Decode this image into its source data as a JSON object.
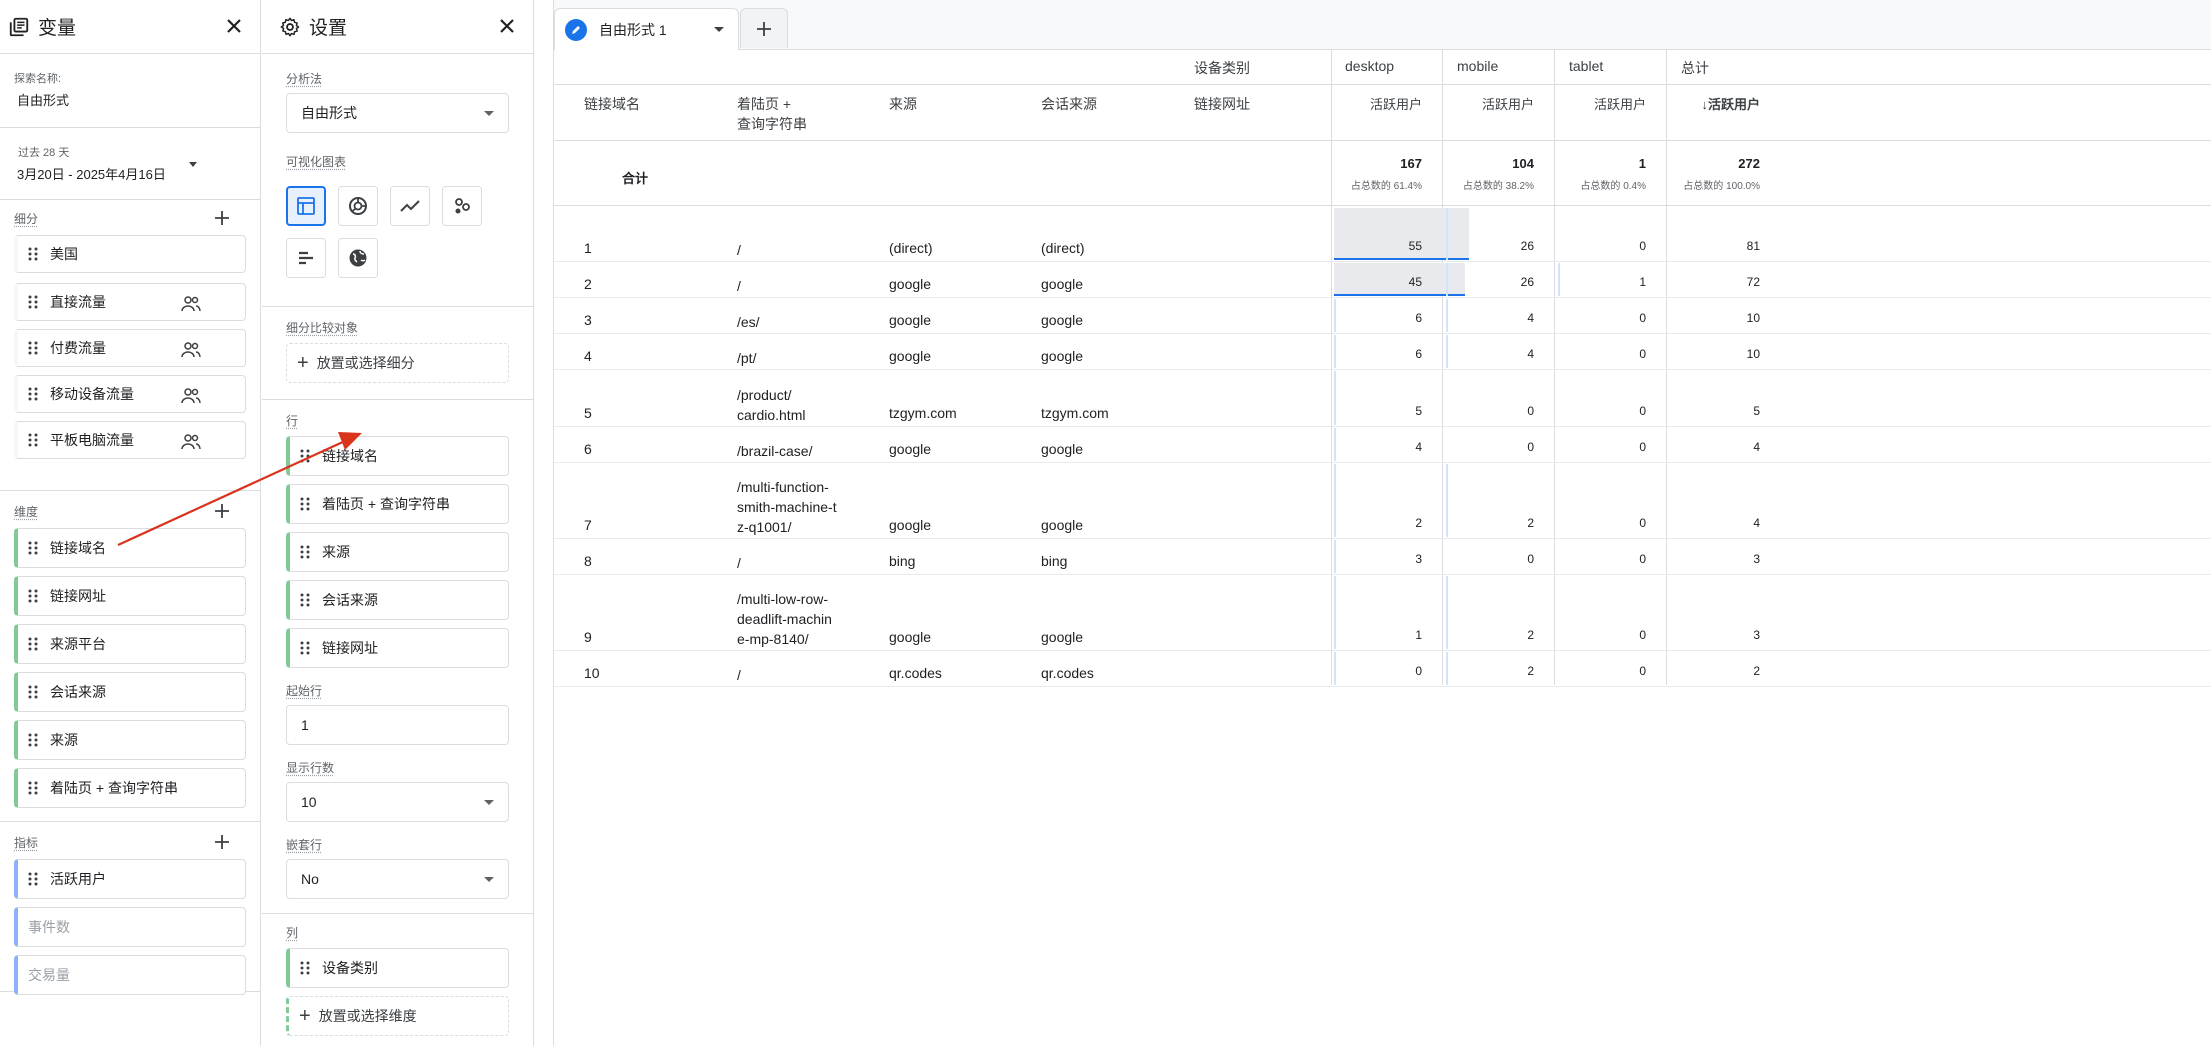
{
  "variables_panel": {
    "title": "变量",
    "exploration_name_label": "探索名称:",
    "exploration_name": "自由形式",
    "date_range_label": "过去 28 天",
    "date_range": "3月20日 - 2025年4月16日",
    "segments_label": "细分",
    "segments": [
      "美国",
      "直接流量",
      "付费流量",
      "移动设备流量",
      "平板电脑流量"
    ],
    "dimensions_label": "维度",
    "dimensions": [
      "链接域名",
      "链接网址",
      "来源平台",
      "会话来源",
      "来源",
      "着陆页 + 查询字符串"
    ],
    "metrics_label": "指标",
    "metrics": [
      "活跃用户",
      "事件数",
      "交易量"
    ]
  },
  "settings_panel": {
    "title": "设置",
    "technique_label": "分析法",
    "technique": "自由形式",
    "viz_label": "可视化图表",
    "segment_compare_label": "细分比较对象",
    "segment_drop": "放置或选择细分",
    "rows_label": "行",
    "rows": [
      "链接域名",
      "着陆页 + 查询字符串",
      "来源",
      "会话来源",
      "链接网址"
    ],
    "start_row_label": "起始行",
    "start_row": "1",
    "show_rows_label": "显示行数",
    "show_rows": "10",
    "nested_rows_label": "嵌套行",
    "nested_rows": "No",
    "columns_label": "列",
    "columns": [
      "设备类别"
    ],
    "dimension_drop": "放置或选择维度"
  },
  "tabs": {
    "active": "自由形式 1"
  },
  "table": {
    "device_category_label": "设备类别",
    "row_headers": [
      "链接域名",
      "着陆页 +\n查询字符串",
      "来源",
      "会话来源",
      "链接网址"
    ],
    "column_groups": [
      "desktop",
      "mobile",
      "tablet",
      "总计"
    ],
    "metric_label": "活跃用户",
    "sorted_metric_label": "↓活跃用户",
    "totals_label": "合计",
    "totals": [
      {
        "value": "167",
        "pct": "占总数的 61.4%"
      },
      {
        "value": "104",
        "pct": "占总数的 38.2%"
      },
      {
        "value": "1",
        "pct": "占总数的 0.4%"
      },
      {
        "value": "272",
        "pct": "占总数的 100.0%"
      }
    ],
    "rows": [
      {
        "n": "1",
        "landing": "/",
        "source": "(direct)",
        "session_source": "(direct)",
        "values": [
          "55",
          "26",
          "0",
          "81"
        ]
      },
      {
        "n": "2",
        "landing": "/",
        "source": "google",
        "session_source": "google",
        "values": [
          "45",
          "26",
          "1",
          "72"
        ]
      },
      {
        "n": "3",
        "landing": "/es/",
        "source": "google",
        "session_source": "google",
        "values": [
          "6",
          "4",
          "0",
          "10"
        ]
      },
      {
        "n": "4",
        "landing": "/pt/",
        "source": "google",
        "session_source": "google",
        "values": [
          "6",
          "4",
          "0",
          "10"
        ]
      },
      {
        "n": "5",
        "landing": "/product/\ncardio.html",
        "source": "tzgym.com",
        "session_source": "tzgym.com",
        "values": [
          "5",
          "0",
          "0",
          "5"
        ]
      },
      {
        "n": "6",
        "landing": "/brazil-case/",
        "source": "google",
        "session_source": "google",
        "values": [
          "4",
          "0",
          "0",
          "4"
        ]
      },
      {
        "n": "7",
        "landing": "/multi-function-\nsmith-machine-t\nz-q1001/",
        "source": "google",
        "session_source": "google",
        "values": [
          "2",
          "2",
          "0",
          "4"
        ]
      },
      {
        "n": "8",
        "landing": "/",
        "source": "bing",
        "session_source": "bing",
        "values": [
          "3",
          "0",
          "0",
          "3"
        ]
      },
      {
        "n": "9",
        "landing": "/multi-low-row-\ndeadlift-machin\ne-mp-8140/",
        "source": "google",
        "session_source": "google",
        "values": [
          "1",
          "2",
          "0",
          "3"
        ]
      },
      {
        "n": "10",
        "landing": "/",
        "source": "qr.codes",
        "session_source": "qr.codes",
        "values": [
          "0",
          "2",
          "0",
          "2"
        ]
      }
    ]
  }
}
